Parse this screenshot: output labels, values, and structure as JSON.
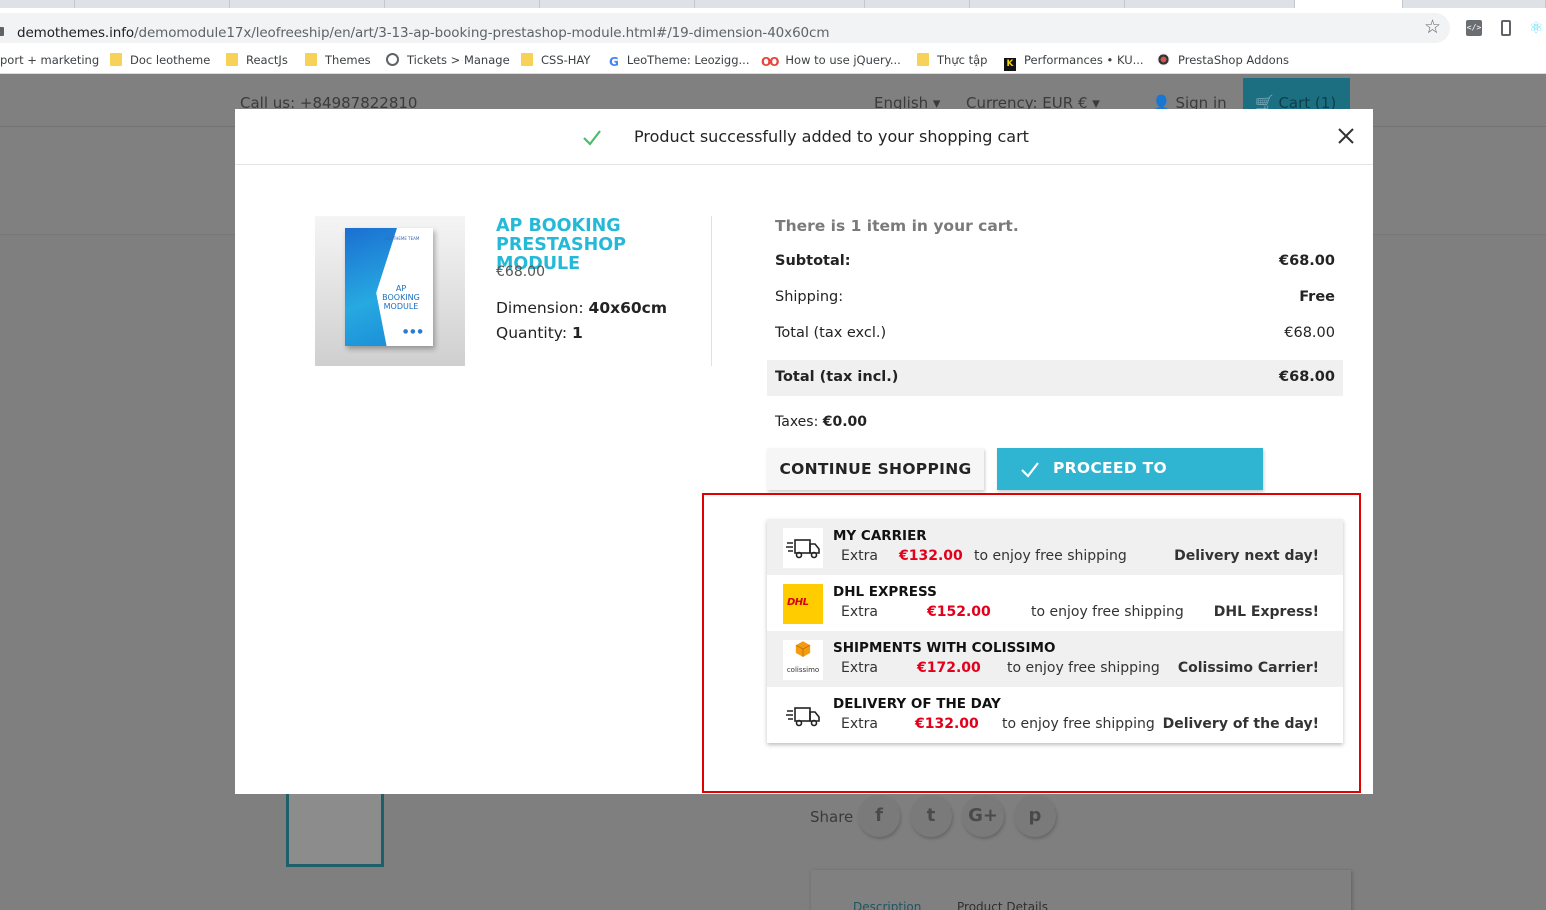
{
  "browser": {
    "url_host": "demothemes.info",
    "url_path": "/demomodule17x/leofreeship/en/art/3-13-ap-booking-prestashop-module.html#/19-dimension-40x60cm",
    "bookmarks": [
      {
        "label": "port + marketing",
        "icon": "none"
      },
      {
        "label": "Doc leotheme",
        "icon": "folder"
      },
      {
        "label": "ReactJs",
        "icon": "folder"
      },
      {
        "label": "Themes",
        "icon": "folder"
      },
      {
        "label": "Tickets > Manage",
        "icon": "globe"
      },
      {
        "label": "CSS-HAY",
        "icon": "folder"
      },
      {
        "label": "LeoTheme: Leozigg...",
        "icon": "google"
      },
      {
        "label": "How to use jQuery...",
        "icon": "oo"
      },
      {
        "label": "Thực tập",
        "icon": "folder"
      },
      {
        "label": "Performances • KU...",
        "icon": "k"
      },
      {
        "label": "PrestaShop Addons",
        "icon": "prestashop"
      }
    ]
  },
  "header": {
    "call": "Call us: +84987822810",
    "language": "English ▾",
    "currency": "Currency: EUR € ▾",
    "signin": "Sign in",
    "cart": "Cart (1)"
  },
  "page": {
    "share": "Share",
    "social_g": "G+",
    "tab_description": "Description",
    "tab_details": "Product Details"
  },
  "modal": {
    "title": "Product successfully added to your shopping cart",
    "product": {
      "name": "AP BOOKING PRESTASHOP MODULE",
      "price": "€68.00",
      "dimension_label": "Dimension: ",
      "dimension_value": "40x60cm",
      "quantity_label": "Quantity: ",
      "quantity_value": "1",
      "image_text": "AP BOOKING MODULE",
      "image_brand": "LEOTHEME TEAM"
    },
    "cart": {
      "count_text": "There is 1 item in your cart.",
      "subtotal_label": "Subtotal:",
      "subtotal_value": "€68.00",
      "shipping_label": "Shipping:",
      "shipping_value": "Free",
      "total_excl_label": "Total (tax excl.)",
      "total_excl_value": "€68.00",
      "total_incl_label": "Total (tax incl.)",
      "total_incl_value": "€68.00",
      "taxes_label": "Taxes: ",
      "taxes_value": "€0.00"
    },
    "buttons": {
      "continue": "CONTINUE SHOPPING",
      "checkout": "PROCEED TO CHECKOUT"
    },
    "carriers": [
      {
        "name": "MY CARRIER",
        "extra": "Extra",
        "amount": "€132.00",
        "enjoy": "to enjoy free shipping",
        "desc": "Delivery next day!",
        "logo": "truck"
      },
      {
        "name": "DHL EXPRESS",
        "extra": "Extra",
        "amount": "€152.00",
        "enjoy": "to enjoy free shipping",
        "desc": "DHL Express!",
        "logo": "dhl"
      },
      {
        "name": "SHIPMENTS WITH COLISSIMO",
        "extra": "Extra",
        "amount": "€172.00",
        "enjoy": "to enjoy free shipping",
        "desc": "Colissimo Carrier!",
        "logo": "colissimo"
      },
      {
        "name": "DELIVERY OF THE DAY",
        "extra": "Extra",
        "amount": "€132.00",
        "enjoy": "to enjoy free shipping",
        "desc": "Delivery of the day!",
        "logo": "truck"
      }
    ],
    "logo_text": {
      "dhl": "DHL",
      "colissimo": "colissimo"
    }
  },
  "colors": {
    "accent": "#2fb5d2",
    "product_name": "#24b9d7",
    "price_red": "#e2001a",
    "highlight": "#e00000",
    "success_check": "#4cbb6c"
  }
}
